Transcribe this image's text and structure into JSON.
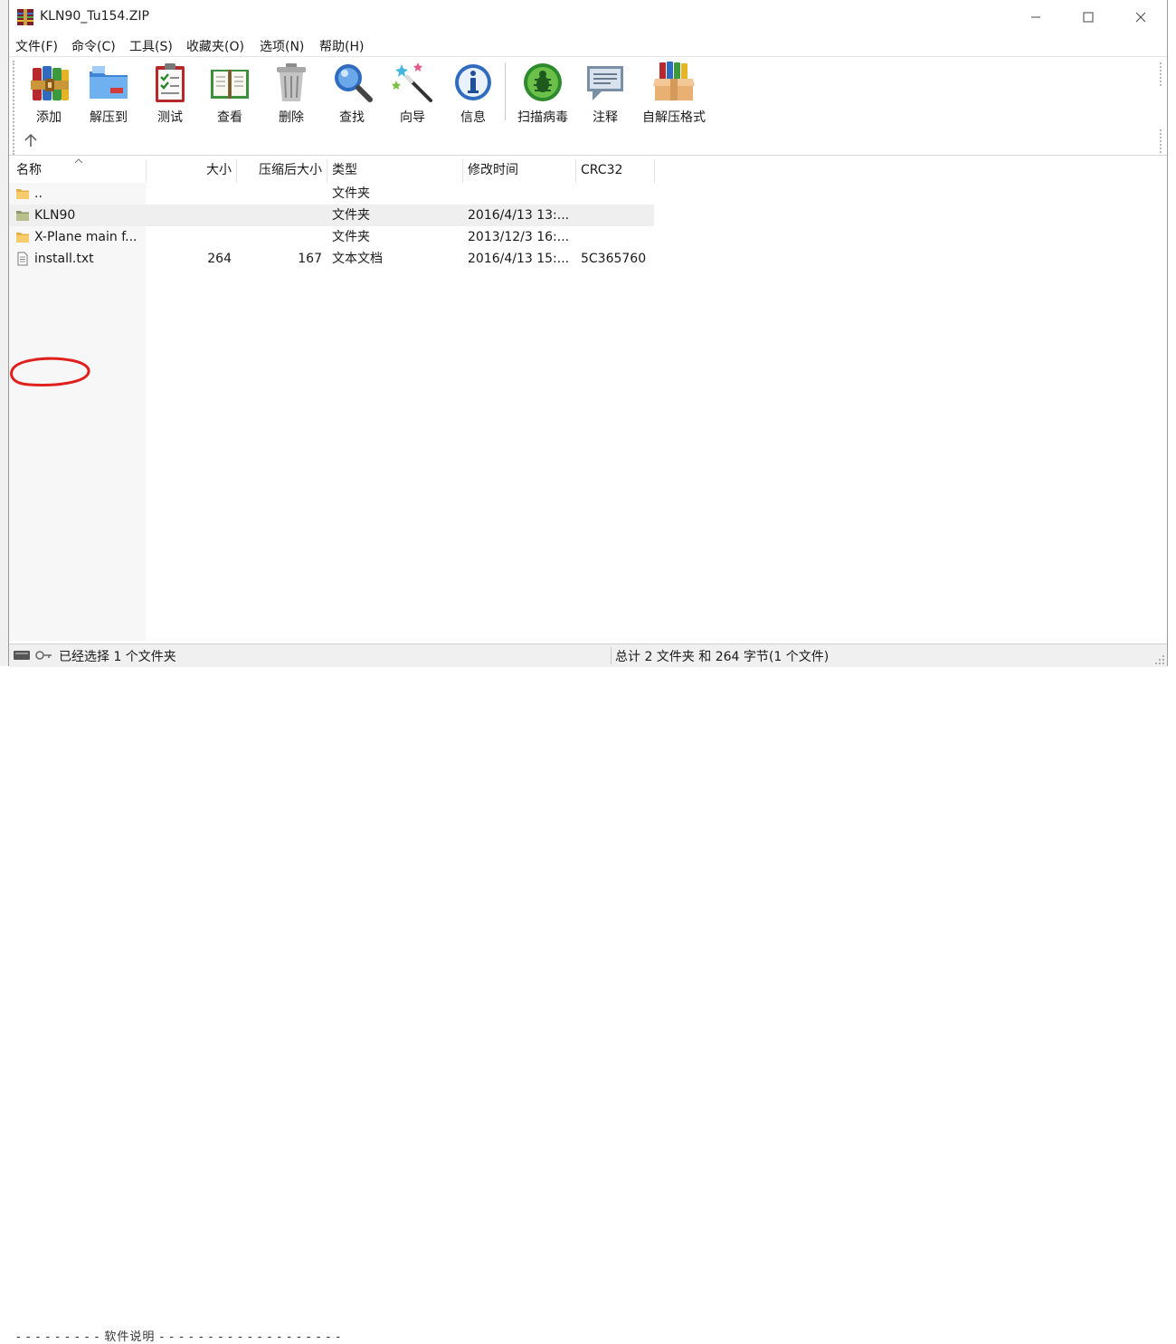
{
  "window": {
    "title": "KLN90_Tu154.ZIP"
  },
  "menu": [
    {
      "label": "文件(F)"
    },
    {
      "label": "命令(C)"
    },
    {
      "label": "工具(S)"
    },
    {
      "label": "收藏夹(O)"
    },
    {
      "label": "选项(N)"
    },
    {
      "label": "帮助(H)"
    }
  ],
  "toolbar": {
    "buttons": [
      {
        "label": "添加",
        "icon": "add-archive-icon"
      },
      {
        "label": "解压到",
        "icon": "extract-to-icon"
      },
      {
        "label": "测试",
        "icon": "test-clipboard-icon"
      },
      {
        "label": "查看",
        "icon": "view-book-icon"
      },
      {
        "label": "删除",
        "icon": "delete-trash-icon"
      },
      {
        "label": "查找",
        "icon": "find-magnifier-icon"
      },
      {
        "label": "向导",
        "icon": "wizard-wand-icon"
      },
      {
        "label": "信息",
        "icon": "info-icon"
      },
      {
        "label": "扫描病毒",
        "icon": "virus-scan-icon"
      },
      {
        "label": "注释",
        "icon": "comment-icon"
      },
      {
        "label": "自解压格式",
        "icon": "sfx-box-icon"
      }
    ],
    "up_icon": "arrow-up-icon"
  },
  "columns": {
    "name": "名称",
    "size": "大小",
    "packed": "压缩后大小",
    "type": "类型",
    "modified": "修改时间",
    "crc": "CRC32"
  },
  "files": [
    {
      "name": "..",
      "size": "",
      "packed": "",
      "type": "文件夹",
      "modified": "",
      "crc": "",
      "icon": "folder-icon",
      "selected": false
    },
    {
      "name": "KLN90",
      "size": "",
      "packed": "",
      "type": "文件夹",
      "modified": "2016/4/13 13:...",
      "crc": "",
      "icon": "folder-icon",
      "selected": true
    },
    {
      "name": "X-Plane main f...",
      "size": "",
      "packed": "",
      "type": "文件夹",
      "modified": "2013/12/3 16:...",
      "crc": "",
      "icon": "folder-icon",
      "selected": false
    },
    {
      "name": "install.txt",
      "size": "264",
      "packed": "167",
      "type": "文本文档",
      "modified": "2016/4/13 15:...",
      "crc": "5C365760",
      "icon": "text-file-icon",
      "selected": false
    }
  ],
  "status": {
    "left": "已经选择 1 个文件夹",
    "right": "总计 2 文件夹 和 264 字节(1 个文件)"
  },
  "background": {
    "bottom_text": "- - - - - - - - - 软件说明 - - - - - - - - - - - - - - - - - - -"
  },
  "colors": {
    "selection": "#efefef",
    "annotation": "#e0201c",
    "folder": "#f2c55c"
  }
}
